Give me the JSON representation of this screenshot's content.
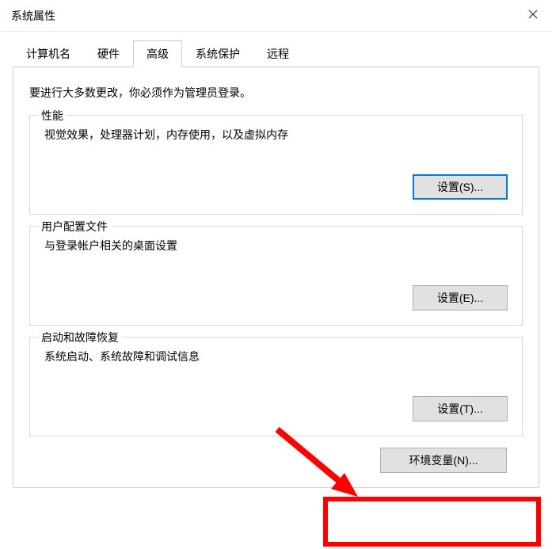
{
  "window": {
    "title": "系统属性"
  },
  "tabs": [
    {
      "label": "计算机名"
    },
    {
      "label": "硬件"
    },
    {
      "label": "高级",
      "active": true
    },
    {
      "label": "系统保护"
    },
    {
      "label": "远程"
    }
  ],
  "intro_text": "要进行大多数更改，你必须作为管理员登录。",
  "groups": {
    "performance": {
      "legend": "性能",
      "desc": "视觉效果，处理器计划，内存使用，以及虚拟内存",
      "button": "设置(S)..."
    },
    "user_profiles": {
      "legend": "用户配置文件",
      "desc": "与登录帐户相关的桌面设置",
      "button": "设置(E)..."
    },
    "startup_recovery": {
      "legend": "启动和故障恢复",
      "desc": "系统启动、系统故障和调试信息",
      "button": "设置(T)..."
    }
  },
  "env_vars_button": "环境变量(N)...",
  "annotation_color": "#ff0000"
}
